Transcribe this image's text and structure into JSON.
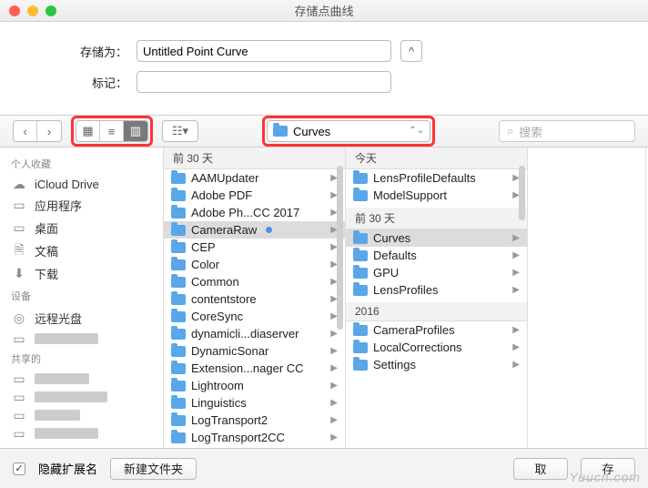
{
  "window": {
    "title": "存储点曲线"
  },
  "form": {
    "save_as_label": "存储为：",
    "save_as_value": "Untitled Point Curve",
    "tag_label": "标记：",
    "tag_value": "",
    "collapse": "^"
  },
  "toolbar": {
    "nav_back": "‹",
    "nav_fwd": "›",
    "path_folder": "Curves",
    "search_placeholder": "搜索"
  },
  "sidebar": {
    "fav_header": "个人收藏",
    "dev_header": "设备",
    "shared_header": "共享的",
    "items": [
      {
        "label": "iCloud Drive",
        "icon": "☁"
      },
      {
        "label": "应用程序",
        "icon": "▭"
      },
      {
        "label": "桌面",
        "icon": "▭"
      },
      {
        "label": "文稿",
        "icon": "🗎"
      },
      {
        "label": "下载",
        "icon": "⬇"
      }
    ],
    "devices": [
      {
        "label": "远程光盘",
        "icon": "◎"
      }
    ]
  },
  "col1": {
    "header": "前 30 天",
    "items": [
      {
        "label": "AAMUpdater"
      },
      {
        "label": "Adobe PDF"
      },
      {
        "label": "Adobe Ph...CC 2017"
      },
      {
        "label": "CameraRaw",
        "selected": true,
        "dot": true
      },
      {
        "label": "CEP"
      },
      {
        "label": "Color"
      },
      {
        "label": "Common"
      },
      {
        "label": "contentstore"
      },
      {
        "label": "CoreSync"
      },
      {
        "label": "dynamicli...diaserver"
      },
      {
        "label": "DynamicSonar"
      },
      {
        "label": "Extension...nager CC"
      },
      {
        "label": "Lightroom"
      },
      {
        "label": "Linguistics"
      },
      {
        "label": "LogTransport2"
      },
      {
        "label": "LogTransport2CC"
      }
    ]
  },
  "col2": {
    "groups": [
      {
        "header": "今天",
        "items": [
          {
            "label": "LensProfileDefaults"
          },
          {
            "label": "ModelSupport"
          }
        ]
      },
      {
        "header": "前 30 天",
        "items": [
          {
            "label": "Curves",
            "selected": true
          },
          {
            "label": "Defaults"
          },
          {
            "label": "GPU"
          },
          {
            "label": "LensProfiles"
          }
        ]
      },
      {
        "header": "2016",
        "items": [
          {
            "label": "CameraProfiles"
          },
          {
            "label": "LocalCorrections"
          },
          {
            "label": "Settings"
          }
        ]
      }
    ]
  },
  "footer": {
    "hide_ext": "隐藏扩展名",
    "new_folder": "新建文件夹",
    "cancel": "取",
    "save": "存"
  },
  "watermark": "Yuucn.com"
}
